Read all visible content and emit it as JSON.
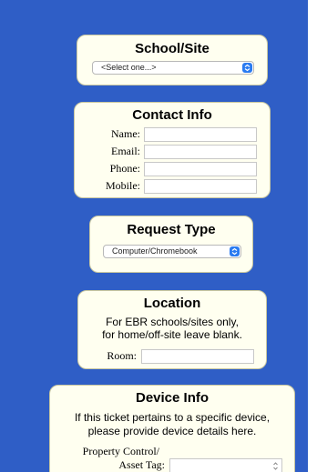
{
  "colors": {
    "background": "#2f5ec6",
    "card": "#fffff0",
    "accent": "#2a7bf1"
  },
  "school_site": {
    "title": "School/Site",
    "select_value": "<Select one...>",
    "chevron_icon": "updown-chevron-icon"
  },
  "contact_info": {
    "title": "Contact Info",
    "fields": [
      {
        "label": "Name:",
        "value": ""
      },
      {
        "label": "Email:",
        "value": ""
      },
      {
        "label": "Phone:",
        "value": ""
      },
      {
        "label": "Mobile:",
        "value": ""
      }
    ]
  },
  "request_type": {
    "title": "Request Type",
    "select_value": "Computer/Chromebook",
    "chevron_icon": "updown-chevron-icon"
  },
  "location": {
    "title": "Location",
    "note_line1": "For EBR schools/sites only,",
    "note_line2": "for home/off-site leave blank.",
    "room_label": "Room:",
    "room_value": ""
  },
  "device_info": {
    "title": "Device Info",
    "note_line1": "If this ticket pertains to a specific device,",
    "note_line2": "please provide device details here.",
    "asset_label_line1": "Property Control/",
    "asset_label_line2": "Asset Tag:",
    "asset_value": "",
    "stepper_icon": "stepper-icon"
  }
}
